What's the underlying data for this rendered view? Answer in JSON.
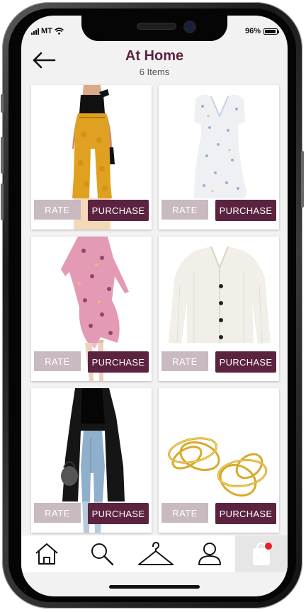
{
  "status_bar": {
    "carrier": "MT",
    "battery": "96%",
    "battery_level": 0.96
  },
  "header": {
    "title": "At Home",
    "subtitle": "6 Items"
  },
  "products": [
    {
      "name": "mustard-trousers",
      "rate_label": "RATE",
      "purchase_label": "PURCHASE"
    },
    {
      "name": "floral-mini-dress",
      "rate_label": "RATE",
      "purchase_label": "PURCHASE"
    },
    {
      "name": "pink-wrap-dress",
      "rate_label": "RATE",
      "purchase_label": "PURCHASE"
    },
    {
      "name": "cream-cardigan",
      "rate_label": "RATE",
      "purchase_label": "PURCHASE"
    },
    {
      "name": "black-long-cardigan",
      "rate_label": "RATE",
      "purchase_label": "PURCHASE"
    },
    {
      "name": "gold-ring-earrings",
      "rate_label": "RATE",
      "purchase_label": "PURCHASE"
    }
  ],
  "nav": [
    {
      "icon": "home-icon"
    },
    {
      "icon": "search-icon"
    },
    {
      "icon": "hanger-icon"
    },
    {
      "icon": "profile-icon"
    },
    {
      "icon": "shopping-bag-icon",
      "active": true,
      "badge": true
    }
  ],
  "colors": {
    "accent": "#5c2340",
    "rate_button": "#c9b9c0",
    "badge": "#e8202a"
  }
}
